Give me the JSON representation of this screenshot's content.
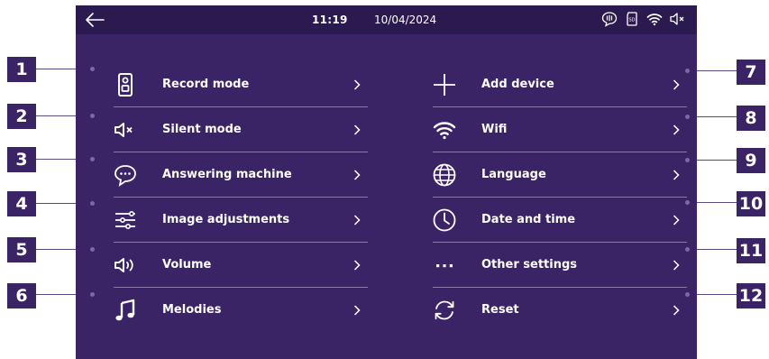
{
  "status": {
    "time": "11:19",
    "date": "10/04/2024",
    "icons": [
      "back-arrow-icon",
      "voicemail-icon",
      "sd-card-icon",
      "wifi-icon",
      "speaker-muted-icon"
    ]
  },
  "menu_left": [
    {
      "label": "Record mode",
      "icon": "doorbell-icon"
    },
    {
      "label": "Silent mode",
      "icon": "speaker-muted-icon"
    },
    {
      "label": "Answering machine",
      "icon": "chat-bubble-icon"
    },
    {
      "label": "Image adjustments",
      "icon": "sliders-icon"
    },
    {
      "label": "Volume",
      "icon": "speaker-volume-icon"
    },
    {
      "label": "Melodies",
      "icon": "music-note-icon"
    }
  ],
  "menu_right": [
    {
      "label": "Add device",
      "icon": "plus-icon"
    },
    {
      "label": "Wifi",
      "icon": "wifi-icon"
    },
    {
      "label": "Language",
      "icon": "globe-icon"
    },
    {
      "label": "Date and time",
      "icon": "clock-icon"
    },
    {
      "label": "Other settings",
      "icon": "ellipsis-icon"
    },
    {
      "label": "Reset",
      "icon": "refresh-icon"
    }
  ],
  "callouts_left": [
    "1",
    "2",
    "3",
    "4",
    "5",
    "6"
  ],
  "callouts_right": [
    "7",
    "8",
    "9",
    "10",
    "11",
    "12"
  ],
  "colors": {
    "screen_bg": "#3a2466",
    "statusbar_bg": "#2b1a4f",
    "callout_bg": "#3a2466",
    "text": "#ffffff",
    "divider": "#8a7bab"
  }
}
